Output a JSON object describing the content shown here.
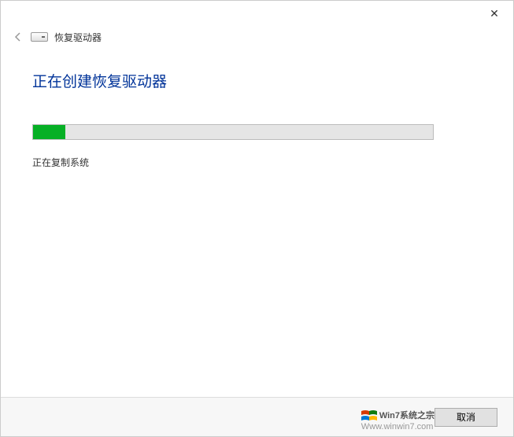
{
  "titlebar": {
    "close_label": "✕"
  },
  "header": {
    "wizard_name": "恢复驱动器"
  },
  "content": {
    "title": "正在创建恢复驱动器",
    "status": "正在复制系统",
    "progress_percent": 8
  },
  "footer": {
    "cancel_label": "取消"
  },
  "watermark": {
    "brand": "Win7系统之宗",
    "url": "Www.winwin7.com"
  }
}
